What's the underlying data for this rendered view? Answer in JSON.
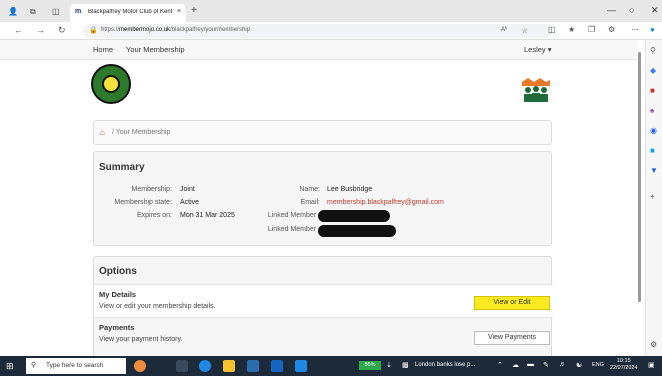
{
  "browser": {
    "tab_title": "Blackpalfrey Motor Club of Kent",
    "tab_favicon": "m",
    "url_prefix": "https://",
    "url_host": "membermojo.co.uk",
    "url_path": "/blackpalfrey/yourmembership",
    "read_aloud_label": "Aʰ",
    "new_tab": "+",
    "tab_close": "×"
  },
  "site_nav": {
    "home": "Home",
    "your_membership": "Your Membership",
    "user_menu": "Lesley ▾"
  },
  "breadcrumb": {
    "current": "Your Membership",
    "separator": "/"
  },
  "summary": {
    "title": "Summary",
    "membership_label": "Membership:",
    "membership_value": "Joint",
    "state_label": "Membership state:",
    "state_value": "Active",
    "expires_label": "Expires on:",
    "expires_value": "Mon 31 Mar 2025",
    "name_label": "Name:",
    "name_value": "Lee Busbridge",
    "email_label": "Email:",
    "email_value": "membership.blackpalfrey@gmail.com",
    "linked1_label": "Linked Member :",
    "linked2_label": "Linked Member :"
  },
  "options": {
    "title": "Options",
    "details_title": "My Details",
    "details_desc": "View or edit your membership details.",
    "details_button": "View or Edit",
    "payments_title": "Payments",
    "payments_desc": "View your payment history.",
    "payments_button": "View Payments"
  },
  "taskbar": {
    "search_placeholder": "Type here to search",
    "battery": "86%",
    "news": "London banks lose p...",
    "lang": "ENG",
    "time": "10:15",
    "date": "22/07/2024"
  },
  "colors": {
    "accent_yellow": "#f9ea1f",
    "link_red": "#c0392b",
    "taskbar": "#1c2a3a"
  }
}
